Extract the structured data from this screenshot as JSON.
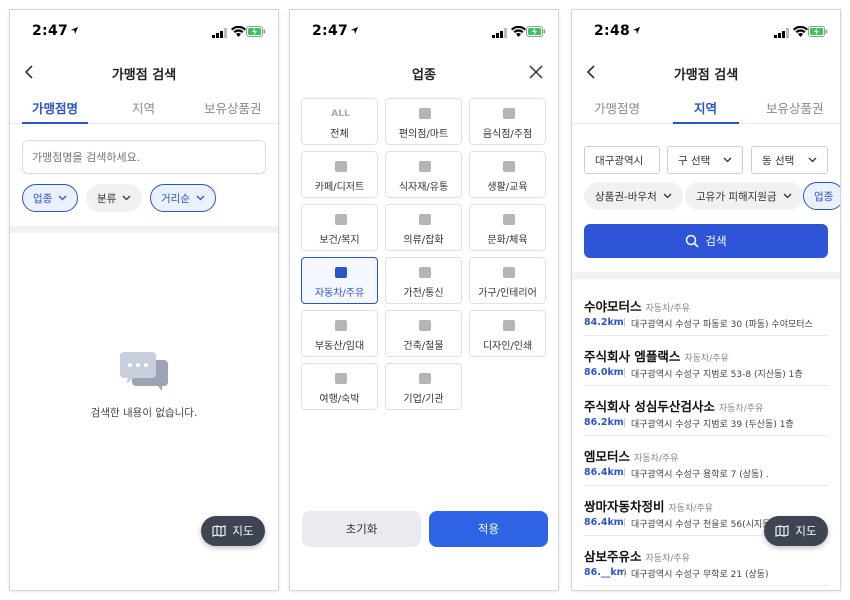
{
  "screen1": {
    "status": {
      "time": "2:47"
    },
    "title": "가맹점 검색",
    "tabs": [
      "가맹점명",
      "지역",
      "보유상품권"
    ],
    "search_placeholder": "가맹점명을 검색하세요.",
    "filters": [
      "업종",
      "분류",
      "거리순"
    ],
    "empty_text": "검색한 내용이 없습니다.",
    "map_button": "지도"
  },
  "screen2": {
    "status": {
      "time": "2:47"
    },
    "title": "업종",
    "categories": [
      {
        "label": "전체",
        "icon": "ALL",
        "selected": false
      },
      {
        "label": "편의점/마트",
        "icon": "basket-icon",
        "selected": false
      },
      {
        "label": "음식점/주점",
        "icon": "utensils-icon",
        "selected": false
      },
      {
        "label": "카페/디저트",
        "icon": "cup-icon",
        "selected": false
      },
      {
        "label": "식자재/유통",
        "icon": "cart-icon",
        "selected": false
      },
      {
        "label": "생활/교육",
        "icon": "abc-icon",
        "selected": false
      },
      {
        "label": "보건/복지",
        "icon": "medkit-icon",
        "selected": false
      },
      {
        "label": "의류/잡화",
        "icon": "shirt-icon",
        "selected": false
      },
      {
        "label": "문화/체육",
        "icon": "camera-icon",
        "selected": false
      },
      {
        "label": "자동차/주유",
        "icon": "car-icon",
        "selected": true
      },
      {
        "label": "가전/통신",
        "icon": "monitor-icon",
        "selected": false
      },
      {
        "label": "가구/인테리어",
        "icon": "sofa-icon",
        "selected": false
      },
      {
        "label": "부동산/임대",
        "icon": "house-icon",
        "selected": false
      },
      {
        "label": "건축/철물",
        "icon": "tools-icon",
        "selected": false
      },
      {
        "label": "디자인/인쇄",
        "icon": "image-icon",
        "selected": false
      },
      {
        "label": "여행/숙박",
        "icon": "bed-icon",
        "selected": false
      },
      {
        "label": "기업/기관",
        "icon": "building-icon",
        "selected": false
      }
    ],
    "reset_label": "초기화",
    "apply_label": "적용"
  },
  "screen3": {
    "status": {
      "time": "2:48"
    },
    "title": "가맹점 검색",
    "tabs": [
      "가맹점명",
      "지역",
      "보유상품권"
    ],
    "region_selects": [
      "대구광역시",
      "구 선택",
      "동 선택"
    ],
    "filters": [
      "상품권-바우처",
      "고유가 피해지원금",
      "업종"
    ],
    "search_label": "검색",
    "results": [
      {
        "name": "수야모터스",
        "category": "자동차/주유",
        "distance": "84.2km",
        "address": "대구광역시 수성구 파동로 30 (파동) 수야모터스"
      },
      {
        "name": "주식회사 엠플랙스",
        "category": "자동차/주유",
        "distance": "86.0km",
        "address": "대구광역시 수성구 지범로 53-8 (지산동) 1층"
      },
      {
        "name": "주식회사 성심두산검사소",
        "category": "자동차/주유",
        "distance": "86.2km",
        "address": "대구광역시 수성구 지범로 39 (두산동) 1층"
      },
      {
        "name": "엠모터스",
        "category": "자동차/주유",
        "distance": "86.4km",
        "address": "대구광역시 수성구 용학로 7 (상동) ."
      },
      {
        "name": "쌍마자동차정비",
        "category": "자동차/주유",
        "distance": "86.4km",
        "address": "대구광역시 수성구 천을로 56(시지동) 쌍마자동..."
      },
      {
        "name": "삼보주유소",
        "category": "자동차/주유",
        "distance": "86.__km",
        "address": "대구광역시 수성구 무학로 21 (상동)"
      }
    ],
    "map_button": "지도"
  }
}
